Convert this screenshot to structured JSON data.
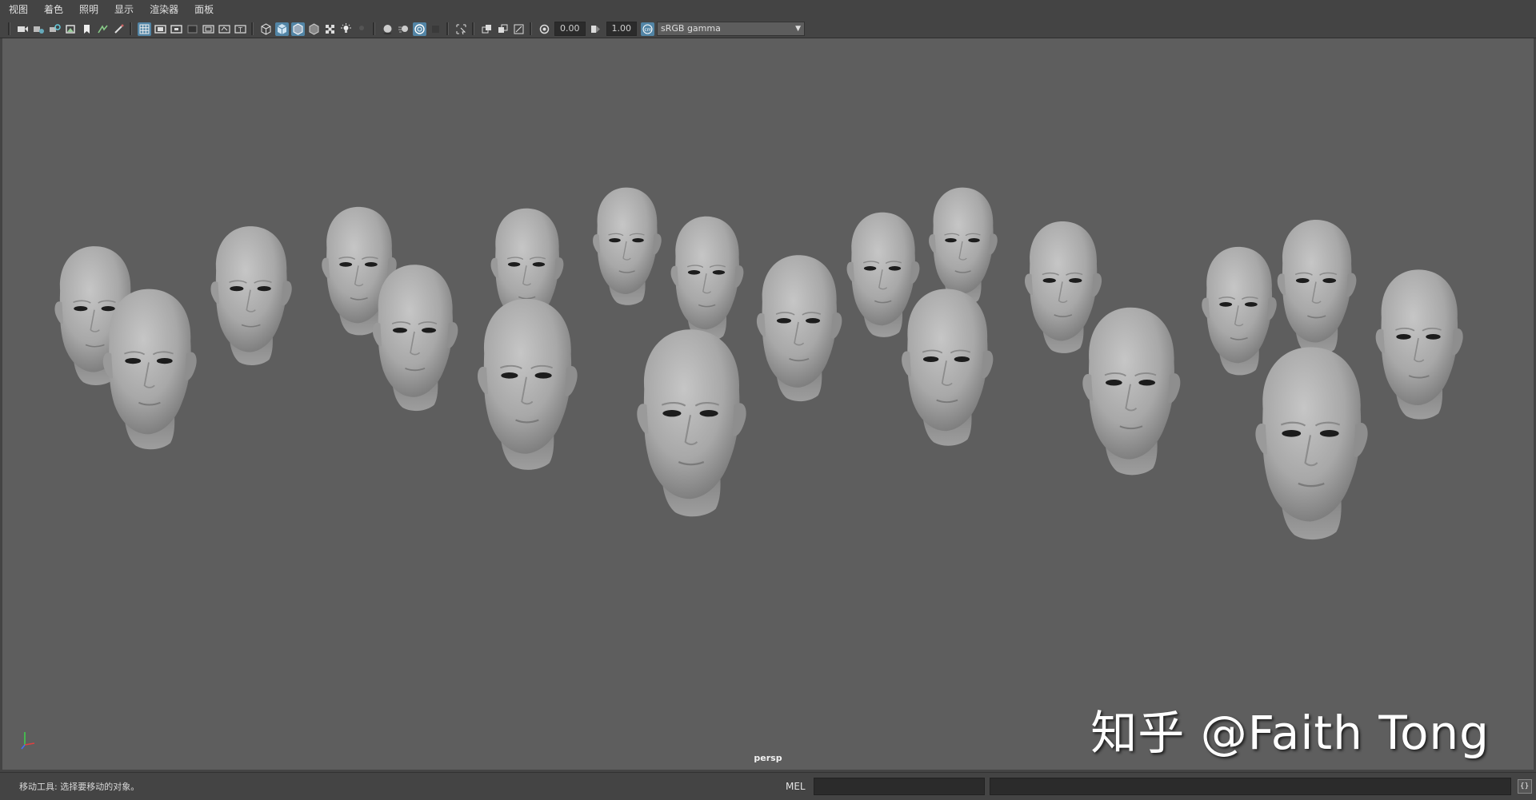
{
  "menubar": {
    "items": [
      "视图",
      "着色",
      "照明",
      "显示",
      "渲染器",
      "面板"
    ]
  },
  "toolbar": {
    "icons_group1": [
      "select-camera-icon",
      "camera-attributes-icon",
      "bookmark-camera-icon",
      "image-plane-icon",
      "bookmark-icon",
      "2d-pan-zoom-icon",
      "grease-pencil-icon"
    ],
    "icons_group2": [
      "grid-icon",
      "film-gate-icon",
      "resolution-gate-icon",
      "gate-mask-icon",
      "field-chart-icon",
      "safe-action-icon",
      "safe-title-icon"
    ],
    "icons_group3": [
      "wireframe-icon",
      "smooth-shade-icon",
      "wireframe-on-shaded-icon",
      "default-material-icon",
      "textured-icon",
      "lights-icon",
      "shadows-icon"
    ],
    "icons_group4": [
      "screen-space-ao-icon",
      "motion-blur-icon",
      "anti-aliasing-icon",
      "depth-of-field-icon"
    ],
    "icons_group5": [
      "isolate-select-icon",
      "xray-icon",
      "xray-joints-icon",
      "backface-icon"
    ],
    "exposure_value": "0.00",
    "gamma_value": "1.00",
    "color_space": "sRGB gamma"
  },
  "viewport": {
    "camera_label": "persp",
    "watermark": "知乎 @Faith Tong"
  },
  "statusbar": {
    "help_text": "移动工具: 选择要移动的对象。",
    "mel_label": "MEL"
  },
  "colors": {
    "viewport_bg": "#5e5e5e",
    "ui_bg": "#444444",
    "active_icon": "#5285a6"
  }
}
